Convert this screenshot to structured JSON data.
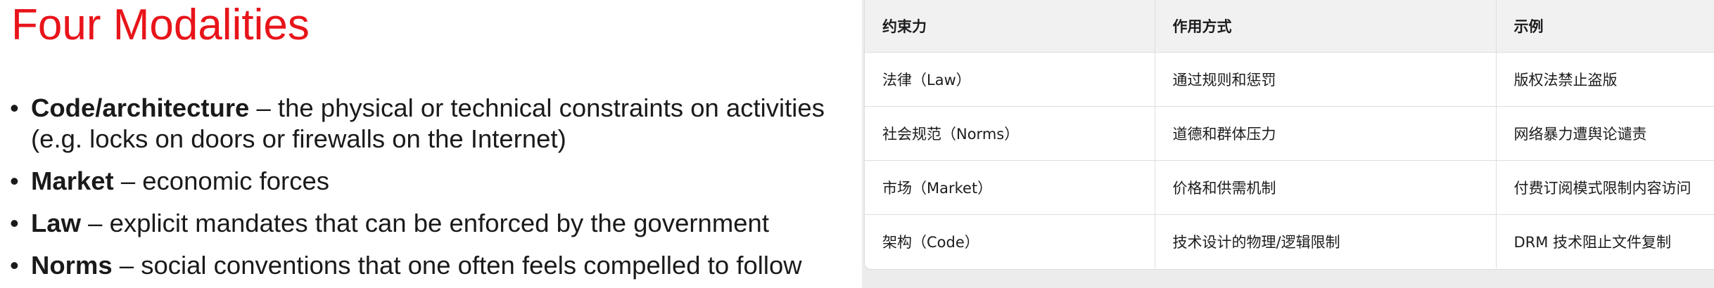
{
  "slide": {
    "title": "Four Modalities",
    "bullet_glyph": "•",
    "bullets": [
      {
        "term": "Code/architecture",
        "rest": " – the physical or technical constraints on activities",
        "line2": "(e.g. locks on doors or firewalls on the Internet)"
      },
      {
        "term": "Market",
        "rest": " – economic forces"
      },
      {
        "term": "Law",
        "rest": " – explicit mandates that can be enforced by the government"
      },
      {
        "term": "Norms",
        "rest": " – social conventions that one often feels compelled to follow"
      }
    ],
    "title_color": "#e8141a"
  },
  "table": {
    "headers": [
      "约束力",
      "作用方式",
      "示例"
    ],
    "rows": [
      [
        "法律（Law）",
        "通过规则和惩罚",
        "版权法禁止盗版"
      ],
      [
        "社会规范（Norms）",
        "道德和群体压力",
        "网络暴力遭舆论谴责"
      ],
      [
        "市场（Market）",
        "价格和供需机制",
        "付费订阅模式限制内容访问"
      ],
      [
        "架构（Code）",
        "技术设计的物理/逻辑限制",
        "DRM 技术阻止文件复制"
      ]
    ]
  }
}
